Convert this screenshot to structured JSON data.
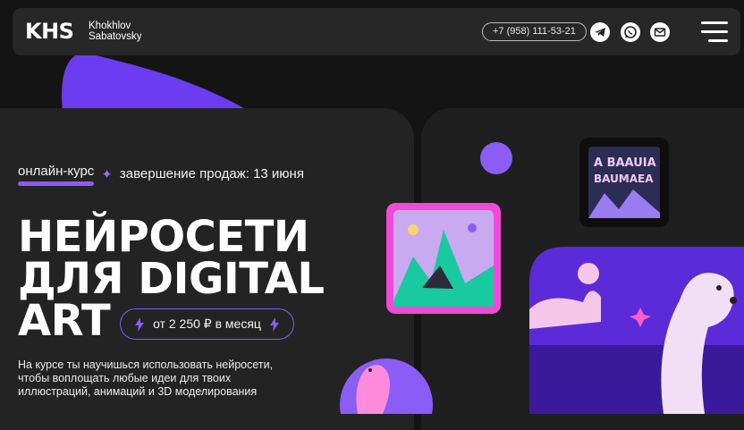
{
  "header": {
    "logo_mark": "KHS",
    "logo_line1": "Khokhlov",
    "logo_line2": "Sabatovsky",
    "phone": "+7 (958) 111-53-21",
    "icons": [
      "telegram-icon",
      "whatsapp-icon",
      "mail-icon",
      "menu-icon"
    ]
  },
  "hero": {
    "course_type": "онлайн-курс",
    "sales_end": "завершение продаж: 13 июня",
    "title_line1": "НЕЙРОСЕТИ",
    "title_line2": "ДЛЯ DIGITAL",
    "title_line3": "ART",
    "price": "от 2 250 ₽ в месяц",
    "description": "На курсе ты научишься использовать нейросети, чтобы воплощать любые идеи для твоих иллюстраций, анимаций и 3D моделирования"
  },
  "colors": {
    "accent": "#8b5cf6",
    "background": "#141414",
    "panel": "#232323"
  }
}
